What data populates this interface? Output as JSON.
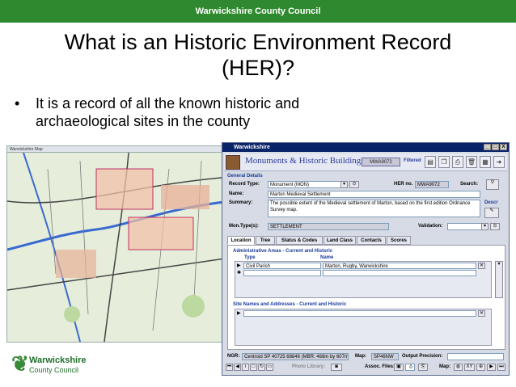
{
  "slide": {
    "header": "Warwickshire County Council",
    "title_line1": "What is an Historic Environment Record",
    "title_line2": "(HER)?",
    "bullet_symbol": "•",
    "bullet_text": "It is a record of all the known historic and archaeological sites in the county",
    "logo_line1": "Warwickshire",
    "logo_line2": "County Council"
  },
  "window": {
    "title": "Warwickshire",
    "app_title": "Monuments & Historic Buildings",
    "record_id": "MWA9072",
    "filtered_label": "Filtered",
    "controls": [
      "_",
      "□",
      "X"
    ]
  },
  "general": {
    "section": "General Details",
    "record_type_label": "Record Type:",
    "record_type_value": "Monument (MON)",
    "her_no_label": "HER no.",
    "her_no_value": "MWA9072",
    "search_label": "Search:",
    "name_label": "Name:",
    "name_value": "Marton Medieval Settlement",
    "summary_label": "Summary:",
    "summary_value": "The possible extent of the Medieval settlement of Marton, based on the first edition Ordnance Survey map.",
    "descr_label": "Descr",
    "mon_type_label": "Mon.Type(s):",
    "mon_type_value": "SETTLEMENT",
    "validation_label": "Validation:"
  },
  "tabs": [
    "Location",
    "Tree",
    "Status & Codes",
    "Land Class",
    "Contacts",
    "Scores"
  ],
  "location": {
    "admin_section": "Administrative Areas - Current and Historic",
    "col_type": "Type",
    "col_name": "Name",
    "row_type": "Civil Parish",
    "row_name": "Marton, Rugby, Warwickshire",
    "site_section": "Site Names and Addresses - Current and Historic"
  },
  "footer": {
    "ngr_label": "NGR:",
    "ngr_value": "Centroid SP 40725 68846  (MBR: 468m by 607m)",
    "map_label": "Map:",
    "map_value": "SP46NW",
    "precision_label": "Output Precision:",
    "photo_label": "Photo Library:",
    "assoc_label": "Assoc. Files:",
    "assoc_count": "0",
    "map2_label": "Map:",
    "xy_label": "XY"
  },
  "map_panel": {
    "caption": "Warwickshire Map"
  }
}
